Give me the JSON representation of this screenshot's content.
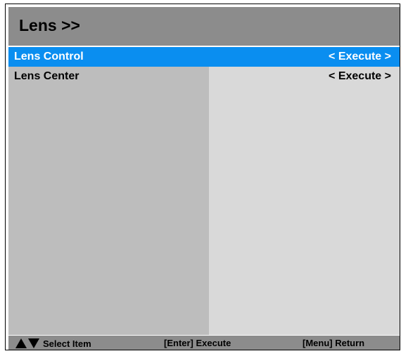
{
  "window": {
    "title": "Lens >>"
  },
  "menu": {
    "items": [
      {
        "label": "Lens Control",
        "value": "< Execute >",
        "selected": true
      },
      {
        "label": "Lens Center",
        "value": "< Execute >",
        "selected": false
      }
    ]
  },
  "footer": {
    "select_icon": "up-down-arrows-icon",
    "select_label": "Select Item",
    "enter_label": "[Enter] Execute",
    "menu_label": "[Menu] Return"
  },
  "colors": {
    "title_bar": "#8c8c8c",
    "selected_row": "#0a8ef0",
    "left_column": "#bdbdbd",
    "right_column": "#d9d9d9"
  }
}
